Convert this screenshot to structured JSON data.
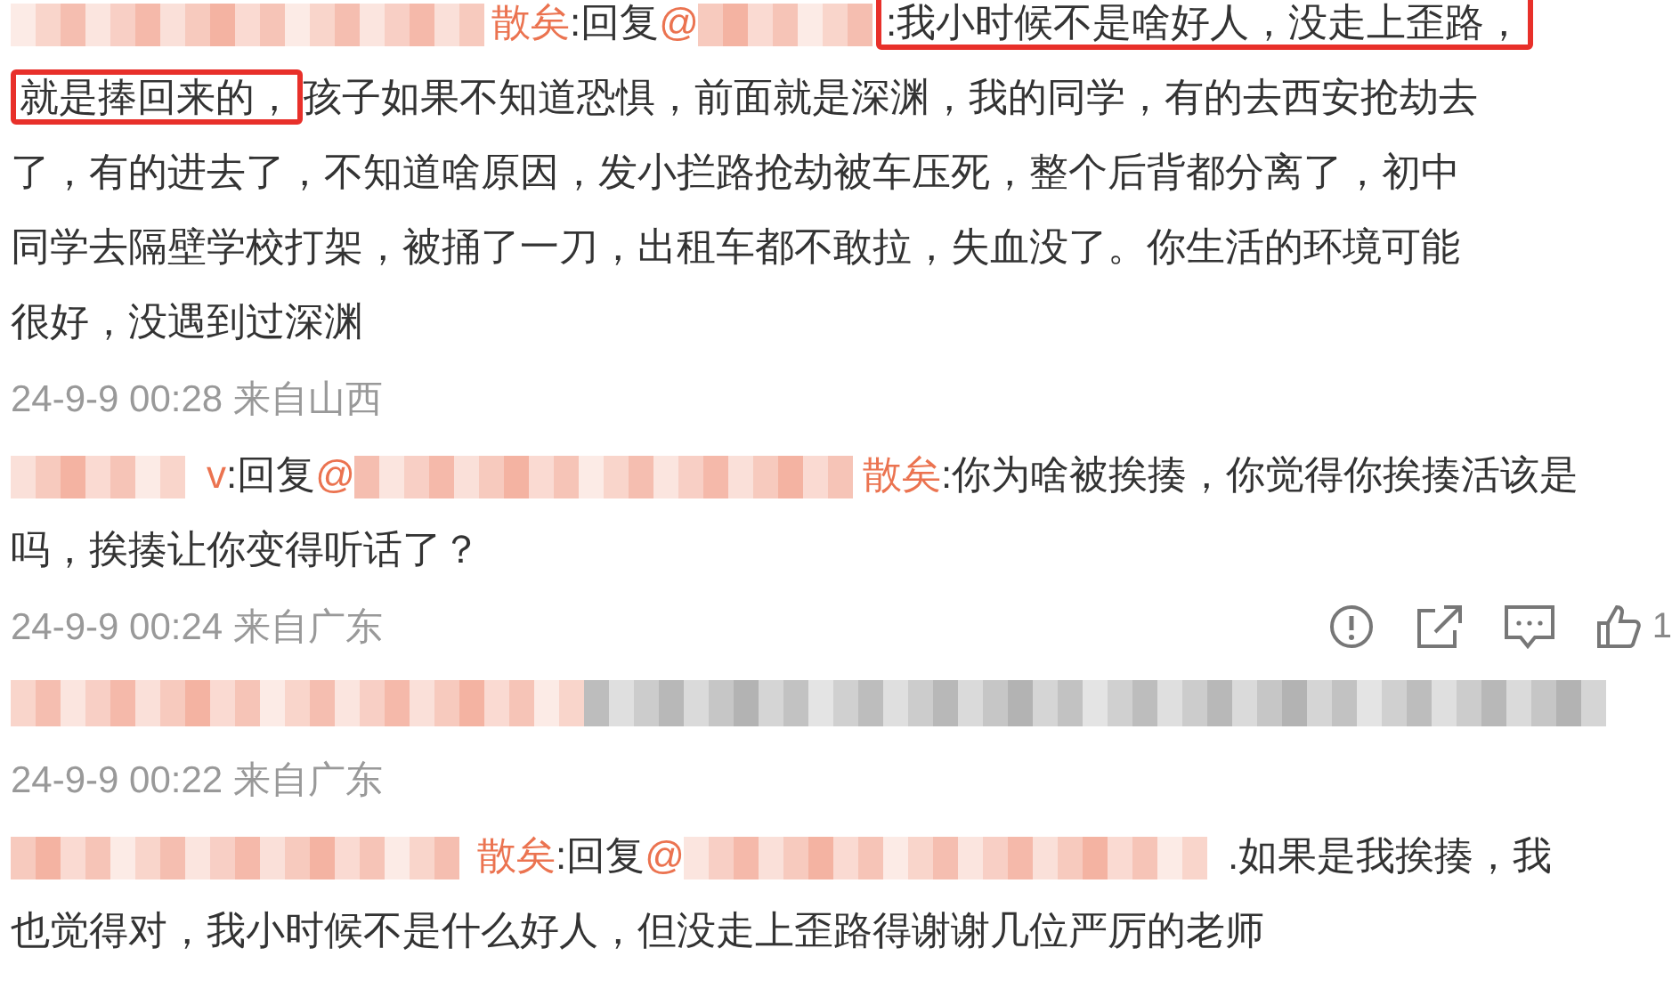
{
  "comments": [
    {
      "author_tail": "散矣",
      "reply_label": ":回复",
      "mention_prefix": "@",
      "first_line": [
        {
          "text": ":我小时候不是啥好人，没走上歪路，",
          "highlighted": true
        }
      ],
      "lines": [
        [
          {
            "text": "就是捧回来的，",
            "highlighted": true
          },
          {
            "text": "孩子如果不知道恐惧，前面就是深渊，我的同学，有的去西安抢劫去",
            "highlighted": false
          }
        ],
        [
          {
            "text": "了，有的进去了，不知道啥原因，发小拦路抢劫被车压死，整个后背都分离了，初中",
            "highlighted": false
          }
        ],
        [
          {
            "text": "同学去隔壁学校打架，被捅了一刀，出租车都不敢拉，失血没了。你生活的环境可能",
            "highlighted": false
          }
        ],
        [
          {
            "text": "很好，没遇到过深渊",
            "highlighted": false
          }
        ]
      ],
      "time": "24-9-9 00:28 来自山西"
    },
    {
      "author_tail": "v",
      "reply_label": ":回复",
      "mention_prefix": "@",
      "mention_tail": "散矣",
      "first_line": [
        {
          "text": ":你为啥被挨揍，你觉得你挨揍活该是",
          "highlighted": false
        }
      ],
      "lines": [
        [
          {
            "text": "吗，挨揍让你变得听话了？",
            "highlighted": false
          }
        ]
      ],
      "time": "24-9-9 00:24 来自广东",
      "actions": {
        "like_count": "1"
      }
    },
    {
      "kind": "hidden",
      "time": "24-9-9 00:22 来自广东"
    },
    {
      "author_tail": "散矣",
      "reply_label": ":回复",
      "mention_prefix": "@",
      "first_line": [
        {
          "text": ".如果是我挨揍，我",
          "highlighted": false
        }
      ],
      "lines": [
        [
          {
            "text": "也觉得对，我小时候不是什么好人，但没走上歪路得谢谢几位严厉的老师",
            "highlighted": false
          }
        ]
      ]
    }
  ]
}
